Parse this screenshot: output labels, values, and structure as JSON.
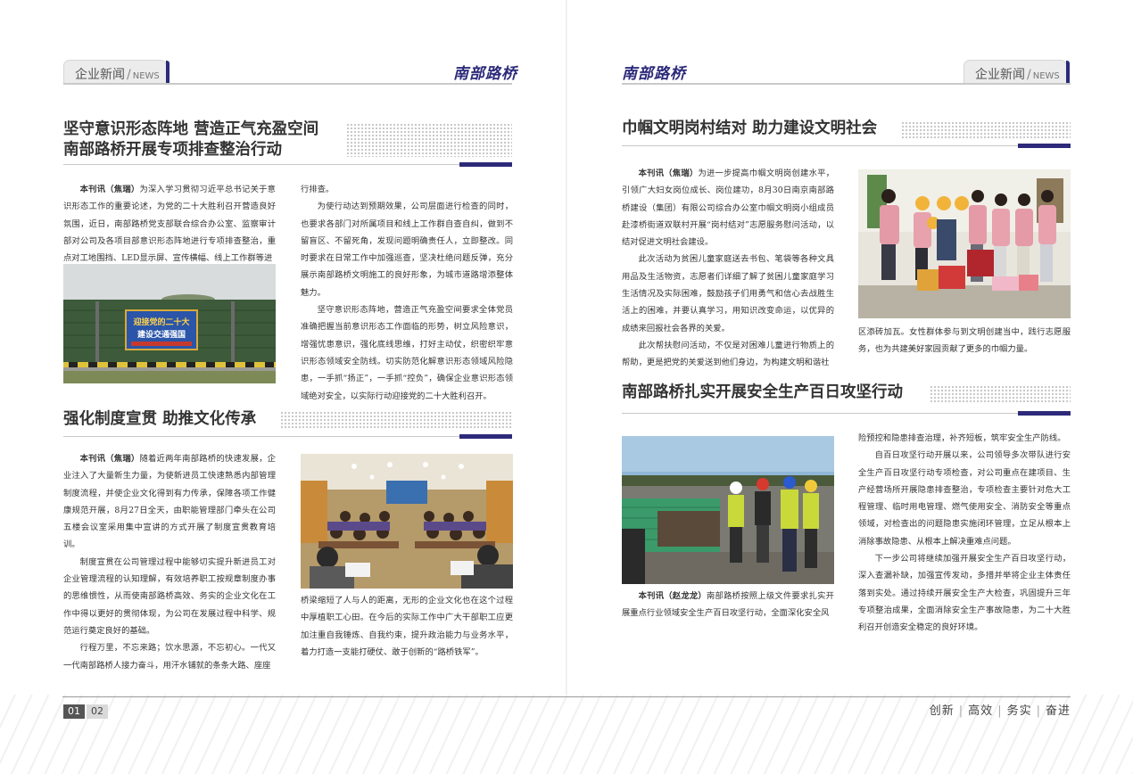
{
  "left_page": {
    "section_tab": {
      "cn": "企业新闻",
      "sep": "/",
      "en": "NEWS"
    },
    "brand": "南部路桥",
    "article1": {
      "title_line1": "坚守意识形态阵地 营造正气充盈空间",
      "title_line2": "南部路桥开展专项排查整治行动",
      "lead_prefix": "本刊讯（焦瑞）",
      "lead": "为深入学习贯彻习近平总书记关于意识形态工作的重要论述，为党的二十大胜利召开营造良好氛围，近日，南部路桥党支部联合综合办公室、监察审计部对公司及各项目部意识形态阵地进行专项排查整治，重点对工地围挡、LED显示屏、宣传横幅、线上工作群等进",
      "col2_p1_cont": "行排查。",
      "col2_p2": "为使行动达到预期效果，公司层面进行检查的同时，也要求各部门对所属项目和线上工作群自查自纠，做到不留盲区、不留死角，发现问题明确责任人，立即整改。同时要求在日常工作中加强巡查，坚决杜绝问题反弹，充分展示南部路桥文明施工的良好形象，为城市道路增添整体魅力。",
      "col2_p3": "坚守意识形态阵地，营造正气充盈空间要求全体党员准确把握当前意识形态工作面临的形势，树立风险意识，增强忧患意识，强化底线思维，打好主动仗，织密织牢意识形态领域安全防线。切实防范化解意识形态领域风险隐患，一手抓“扬正”，一手抓“控负”，确保企业意识形态领域绝对安全，以实际行动迎接党的二十大胜利召开。",
      "photo_banner_text": "迎接党的二十大 建设交通强国"
    },
    "article2": {
      "title": "强化制度宣贯 助推文化传承",
      "lead_prefix": "本刊讯（焦瑞）",
      "lead": "随着近两年南部路桥的快速发展，企业注入了大量新生力量，为使新进员工快速熟悉内部管理制度流程，并使企业文化得到有力传承，保障各项工作健康规范开展，8月27日全天，由职能管理部门牵头在公司五楼会议室采用集中宣讲的方式开展了制度宣贯教育培训。",
      "p2": "制度宣贯在公司管理过程中能够切实提升新进员工对企业管理流程的认知理解，有效培养职工按规章制度办事的思维惯性，从而使南部路桥高效、务实的企业文化在工作中得以更好的贯彻体现，为公司在发展过程中科学、规范运行奠定良好的基础。",
      "p3": "行程万里，不忘来路；饮水思源，不忘初心。一代又一代南部路桥人接力奋斗，用汗水铺就的条条大路、座座",
      "col2_cont": "桥梁缩短了人与人的距离，无形的企业文化也在这个过程中厚植职工心田。在今后的实际工作中广大干部职工应更加注重自我锤炼、自我约束，提升政治能力与业务水平，着力打造一支能打硬仗、敢于创新的“路桥铁军”。"
    }
  },
  "right_page": {
    "section_tab": {
      "cn": "企业新闻",
      "sep": "/",
      "en": "NEWS"
    },
    "brand": "南部路桥",
    "article3": {
      "title": "巾帼文明岗村结对 助力建设文明社会",
      "lead_prefix": "本刊讯（焦瑞）",
      "lead": "为进一步提高巾帼文明岗创建水平，引领广大妇女岗位成长、岗位建功，8月30日南京南部路桥建设（集团）有限公司综合办公室巾帼文明岗小组成员赴漆桥街道双联村开展“岗村结对”志愿服务慰问活动，以结对促进文明社会建设。",
      "p2": "此次活动为贫困儿童家庭送去书包、笔袋等各种文具用品及生活物资，志愿者们详细了解了贫困儿童家庭学习生活情况及实际困难，鼓励孩子们用勇气和信心去战胜生活上的困难，并要认真学习，用知识改变命运，以优异的成绩来回报社会各界的关爱。",
      "p3": "此次帮扶慰问活动，不仅是对困难儿童进行物质上的帮助，更是把党的关爱送到他们身边，为构建文明和谐社",
      "col2_cont": "区添砖加瓦。女性群体参与到文明创建当中，践行志愿服务，也为共建美好家园贡献了更多的巾帼力量。"
    },
    "article4": {
      "title": "南部路桥扎实开展安全生产百日攻坚行动",
      "lead_prefix": "本刊讯（赵龙龙）",
      "lead": "南部路桥按照上级文件要求扎实开展重点行业领域安全生产百日攻坚行动，全面深化安全风",
      "col2_cont": "险预控和隐患排查治理，补齐短板，筑牢安全生产防线。",
      "p2": "自百日攻坚行动开展以来，公司领导多次带队进行安全生产百日攻坚行动专项检查，对公司重点在建项目、生产经营场所开展隐患排查整治，专项检查主要针对危大工程管理、临时用电管理、燃气使用安全、消防安全等重点领域，对检查出的问题隐患实施闭环管理，立足从根本上消除事故隐患、从根本上解决重难点问题。",
      "p3": "下一步公司将继续加强开展安全生产百日攻坚行动，深入查漏补缺，加强宣传发动，多措并举将企业主体责任落到实处。通过持续开展安全生产大检查，巩固提升三年专项整治成果，全面消除安全生产事故隐患，为二十大胜利召开创造安全稳定的良好环境。"
    }
  },
  "footer": {
    "page_left": "01",
    "page_right": "02",
    "slogans": [
      "创新",
      "高效",
      "务实",
      "奋进"
    ]
  },
  "colors": {
    "accent": "#2d2a7a",
    "rule": "#c8c8c8",
    "tab_bg": "#ececec"
  }
}
